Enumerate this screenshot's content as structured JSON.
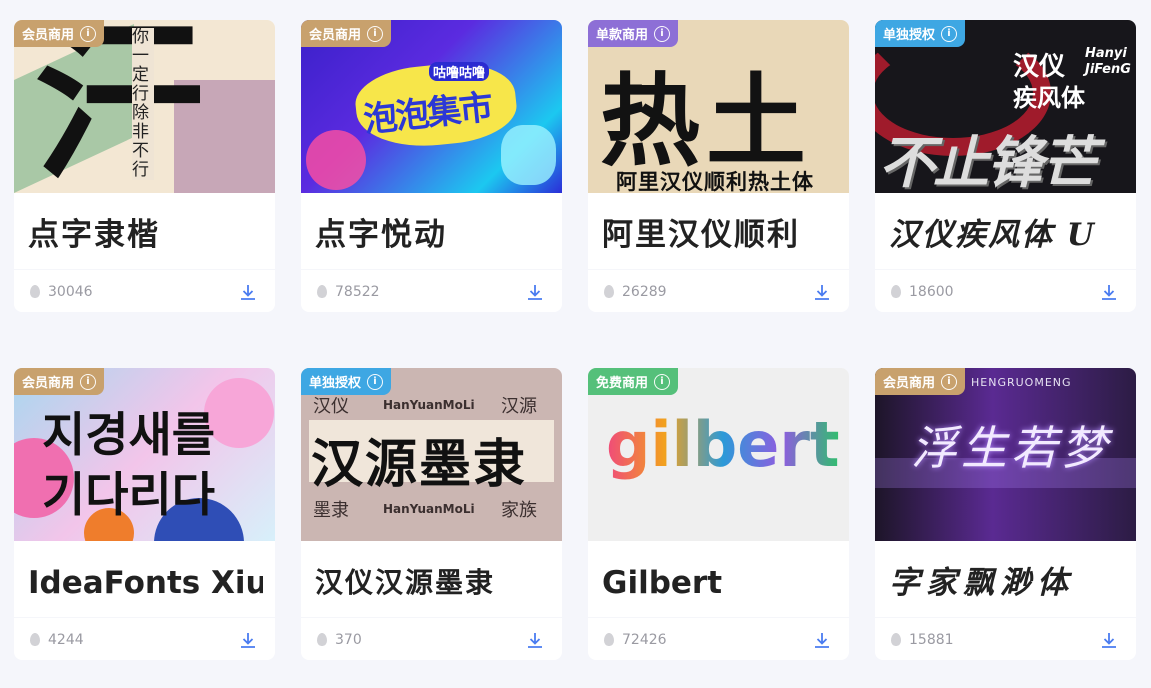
{
  "badges": {
    "member": "会员商用",
    "single": "单独授权",
    "single_buy": "单款商用",
    "free": "免费商用"
  },
  "cards": [
    {
      "title": "点字隶楷",
      "count": "30046",
      "cover": {
        "main": "汗",
        "side": "你一定行除非不行"
      }
    },
    {
      "title": "点字悦动",
      "count": "78522",
      "cover": {
        "main": "泡泡集市",
        "sub": "咕噜咕噜"
      }
    },
    {
      "title": "阿里汉仪顺利",
      "count": "26289",
      "cover": {
        "main": "热土",
        "sub": "阿里汉仪顺利热土体"
      }
    },
    {
      "title": "汉仪疾风体 U",
      "count": "18600",
      "cover": {
        "main": "不止锋芒",
        "sub1": "汉仪",
        "sub2": "疾风体",
        "en1": "Hanyi",
        "en2": "JiFenG"
      }
    },
    {
      "title": "IdeaFonts Xiu",
      "count": "4244",
      "cover": {
        "line1": "지경새를",
        "line2": "기다리다"
      }
    },
    {
      "title": "汉仪汉源墨隶",
      "count": "370",
      "cover": {
        "main": "汉源墨隶",
        "en": "HanYuanMoLi",
        "s1": "汉仪",
        "s2": "汉源",
        "s3": "墨隶",
        "s4": "家族"
      }
    },
    {
      "title": "Gilbert",
      "count": "72426",
      "cover": {
        "main": "gilbert"
      }
    },
    {
      "title": "字家飘渺体",
      "count": "15881",
      "cover": {
        "main": "浮生若梦",
        "top": "HENGRUOMENG"
      }
    }
  ],
  "icons": {
    "info": "info-icon",
    "fire": "fire-icon",
    "download": "download-icon"
  },
  "colors": {
    "member": "#c8a16d",
    "single": "#3ea7e3",
    "single_buy": "#8d6fd6",
    "free": "#55c07a",
    "download": "#4a7cf0"
  }
}
